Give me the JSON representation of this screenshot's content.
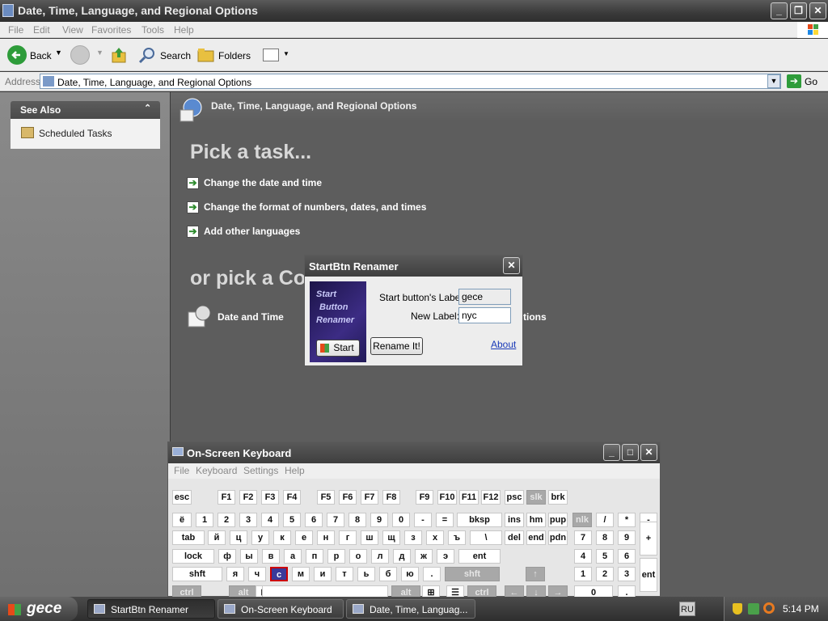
{
  "window": {
    "title": "Date, Time, Language, and Regional Options"
  },
  "menu": [
    "File",
    "Edit",
    "View",
    "Favorites",
    "Tools",
    "Help"
  ],
  "toolbar": {
    "back": "Back",
    "search": "Search",
    "folders": "Folders"
  },
  "address": {
    "label": "Address",
    "value": "Date, Time, Language, and Regional Options",
    "go": "Go"
  },
  "sidebar": {
    "header": "See Also",
    "items": [
      "Scheduled Tasks"
    ]
  },
  "main": {
    "header": "Date, Time, Language, and Regional Options",
    "pick_task": "Pick a task...",
    "tasks": [
      "Change the date and time",
      "Change the format of numbers, dates, and times",
      "Add other languages"
    ],
    "pick_icon": "or pick a Co",
    "icons": [
      "Date and Time",
      "tions"
    ]
  },
  "dialog": {
    "title": "StartBtn Renamer",
    "logo_text": [
      "Start",
      "Button",
      "Renamer"
    ],
    "start_label": "Start button's Label:",
    "start_value": "gece",
    "new_label": "New Label:",
    "new_value": "nyc",
    "preview_button": "Start",
    "rename_button": "Rename It!",
    "about_link": "About"
  },
  "osk": {
    "title": "On-Screen Keyboard",
    "menu": [
      "File",
      "Keyboard",
      "Settings",
      "Help"
    ],
    "rows": {
      "fn": [
        "esc",
        "F1",
        "F2",
        "F3",
        "F4",
        "F5",
        "F6",
        "F7",
        "F8",
        "F9",
        "F10",
        "F11",
        "F12",
        "psc",
        "slk",
        "brk"
      ],
      "num": [
        "ё",
        "1",
        "2",
        "3",
        "4",
        "5",
        "6",
        "7",
        "8",
        "9",
        "0",
        "-",
        "=",
        "bksp",
        "ins",
        "hm",
        "pup",
        "nlk",
        "/",
        "*",
        "-"
      ],
      "top": [
        "tab",
        "й",
        "ц",
        "у",
        "к",
        "е",
        "н",
        "г",
        "ш",
        "щ",
        "з",
        "х",
        "ъ",
        "\\",
        "del",
        "end",
        "pdn",
        "7",
        "8",
        "9",
        "+"
      ],
      "mid": [
        "lock",
        "ф",
        "ы",
        "в",
        "а",
        "п",
        "р",
        "о",
        "л",
        "д",
        "ж",
        "э",
        "ent",
        "4",
        "5",
        "6"
      ],
      "bot": [
        "shft",
        "я",
        "ч",
        "с",
        "м",
        "и",
        "т",
        "ь",
        "б",
        "ю",
        ".",
        "shft",
        "1",
        "2",
        "3",
        "ent"
      ],
      "sp": [
        "ctrl",
        "alt",
        "alt",
        "ctrl",
        "0",
        "."
      ]
    }
  },
  "taskbar": {
    "start": "gece",
    "buttons": [
      "StartBtn Renamer",
      "On-Screen Keyboard",
      "Date, Time, Languag..."
    ],
    "lang": "RU",
    "clock": "5:14 PM"
  }
}
